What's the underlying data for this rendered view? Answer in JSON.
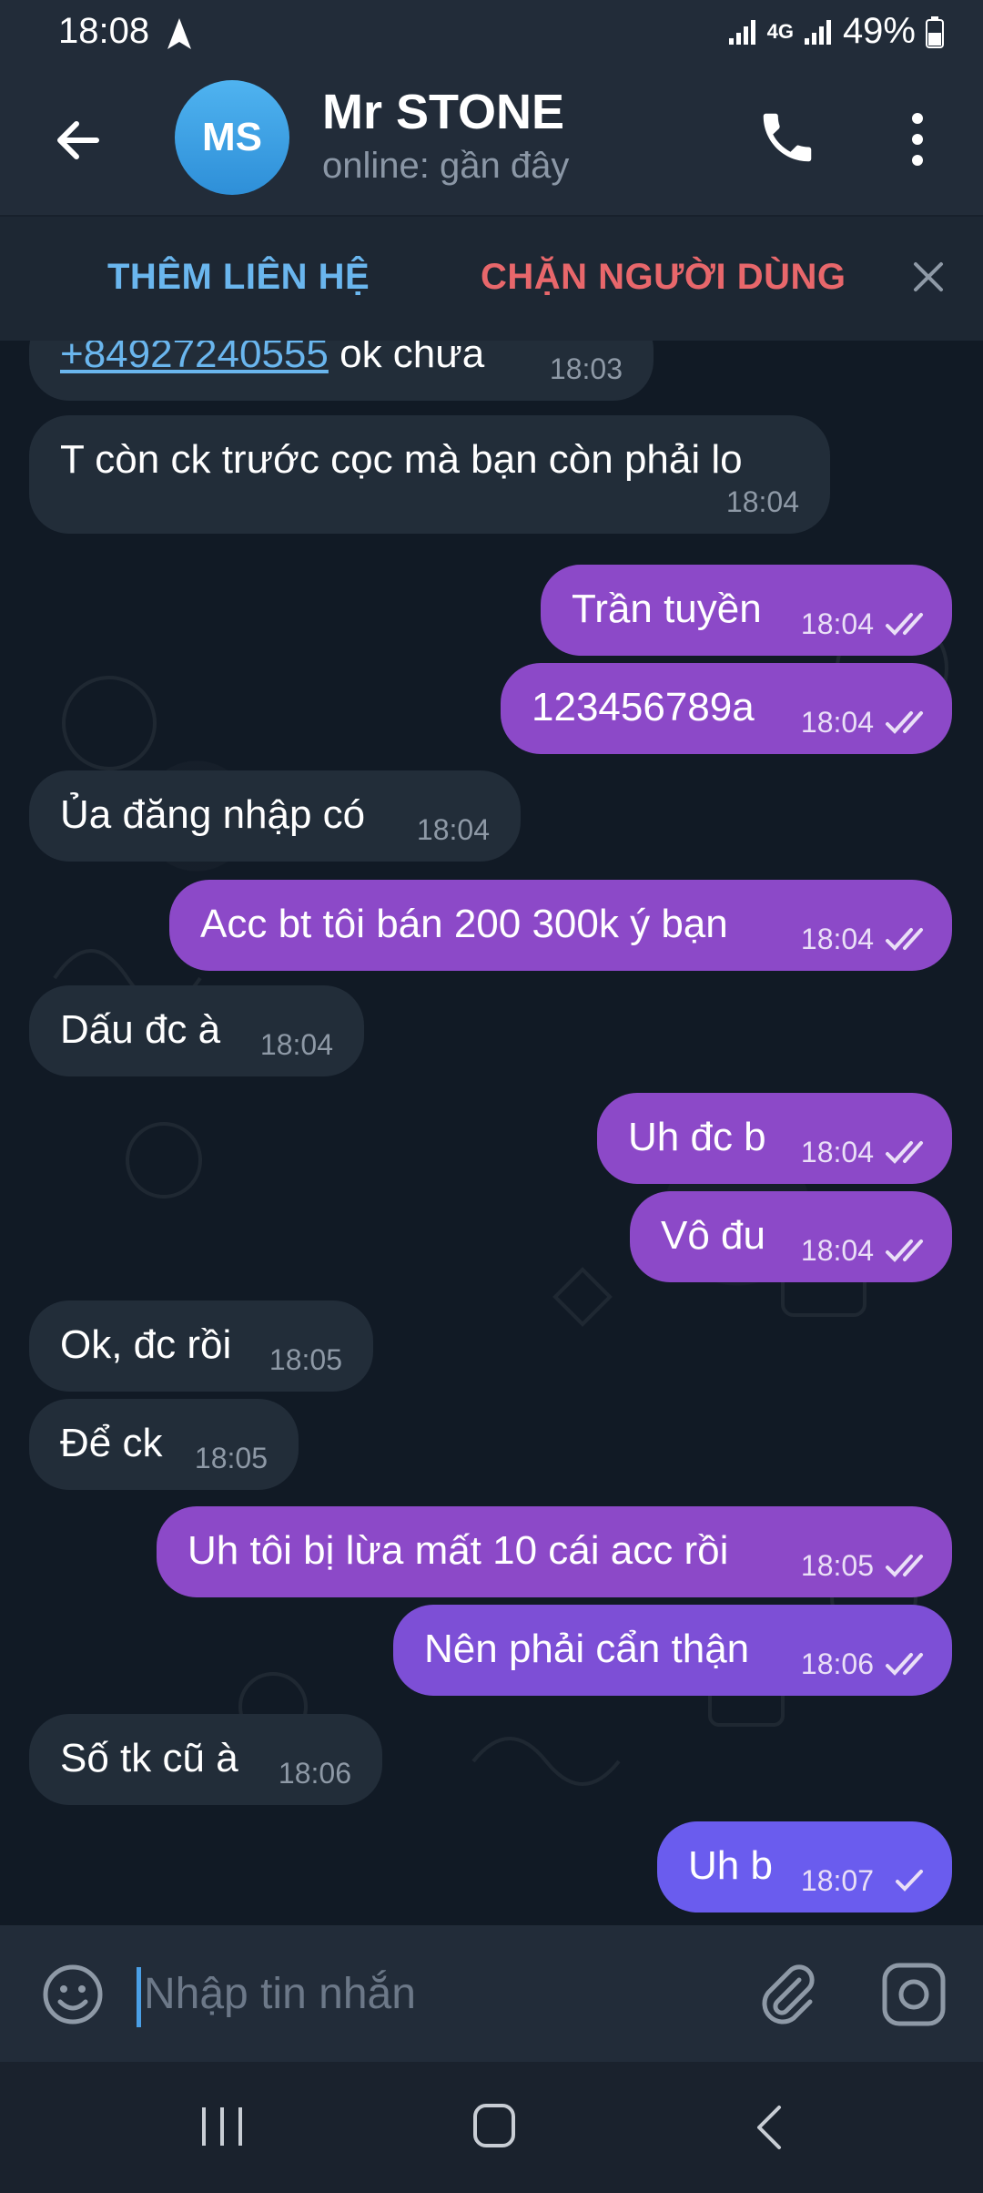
{
  "status_bar": {
    "time": "18:08",
    "network": "4G",
    "battery": "49%"
  },
  "header": {
    "avatar_initials": "MS",
    "title": "Mr STONE",
    "subtitle": "online: gần đây"
  },
  "action_bar": {
    "add_contact": "THÊM LIÊN HỆ",
    "block_user": "CHẶN NGƯỜI DÙNG"
  },
  "messages": [
    {
      "dir": "in",
      "link": "+84927240555",
      "text": " ok chưa",
      "time": "18:03"
    },
    {
      "dir": "in",
      "text": "T còn ck trước cọc mà bạn còn phải lo",
      "time": "18:04"
    },
    {
      "dir": "out",
      "text": "Trần tuyền",
      "time": "18:04",
      "status": "read"
    },
    {
      "dir": "out",
      "text": "123456789a",
      "time": "18:04",
      "status": "read"
    },
    {
      "dir": "in",
      "text": "Ủa đăng nhập có",
      "time": "18:04"
    },
    {
      "dir": "out",
      "text": "Acc bt tôi bán 200 300k ý bạn",
      "time": "18:04",
      "status": "read"
    },
    {
      "dir": "in",
      "text": "Dấu đc à",
      "time": "18:04"
    },
    {
      "dir": "out",
      "text": "Uh đc b",
      "time": "18:04",
      "status": "read"
    },
    {
      "dir": "out",
      "text": "Vô đu",
      "time": "18:04",
      "status": "read"
    },
    {
      "dir": "in",
      "text": "Ok, đc rồi",
      "time": "18:05"
    },
    {
      "dir": "in",
      "text": "Để ck",
      "time": "18:05"
    },
    {
      "dir": "out",
      "text": "Uh tôi bị lừa mất 10 cái acc rồi",
      "time": "18:05",
      "status": "read"
    },
    {
      "dir": "out",
      "text": "Nên phải cẩn thận",
      "time": "18:06",
      "status": "read"
    },
    {
      "dir": "in",
      "text": "Số tk cũ à",
      "time": "18:06"
    },
    {
      "dir": "out",
      "text": "Uh b",
      "time": "18:07",
      "status": "sent"
    }
  ],
  "input": {
    "placeholder": "Nhập tin nhắn"
  },
  "icons": {
    "back": "arrow-left-icon",
    "call": "phone-icon",
    "more": "more-vertical-icon",
    "close": "close-icon",
    "emoji": "emoji-icon",
    "attach": "paperclip-icon",
    "camera": "camera-icon",
    "read": "double-check-icon",
    "sent": "check-icon"
  },
  "colors": {
    "outgoing_bubble": "#8c49c8",
    "incoming_bubble": "#222d39",
    "link": "#6ab6ee",
    "block_text": "#e8676b"
  }
}
